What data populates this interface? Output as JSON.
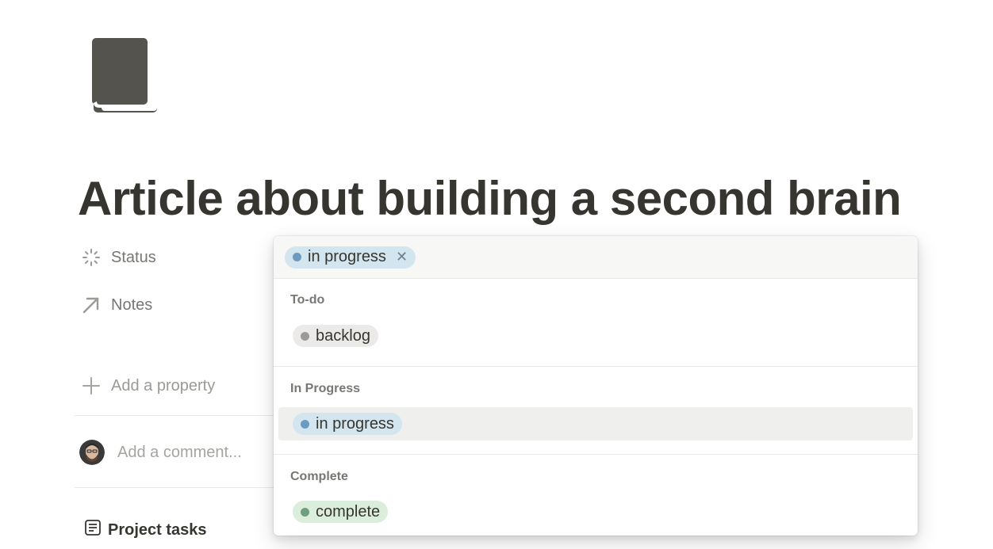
{
  "page": {
    "icon": "book-icon",
    "title": "Article about building a second brain"
  },
  "properties": [
    {
      "label": "Status",
      "icon": "status-spinner-icon"
    },
    {
      "label": "Notes",
      "icon": "arrow-up-right-icon"
    }
  ],
  "add_property": {
    "label": "Add a property",
    "icon": "plus-icon"
  },
  "comment": {
    "placeholder": "Add a comment..."
  },
  "tasks": {
    "label": "Project tasks",
    "icon": "document-icon"
  },
  "dropdown": {
    "selected_tag": {
      "label": "in progress",
      "color": "#6c9bc0",
      "bg": "#d3e5ef"
    },
    "groups": [
      {
        "label": "To-do",
        "options": [
          {
            "label": "backlog",
            "color": "#9b9a97",
            "bg": "#ebeae8"
          }
        ]
      },
      {
        "label": "In Progress",
        "options": [
          {
            "label": "in progress",
            "color": "#6c9bc0",
            "bg": "#d3e5ef"
          }
        ]
      },
      {
        "label": "Complete",
        "options": [
          {
            "label": "complete",
            "color": "#6f9f7e",
            "bg": "#dbeddb"
          }
        ]
      }
    ]
  }
}
